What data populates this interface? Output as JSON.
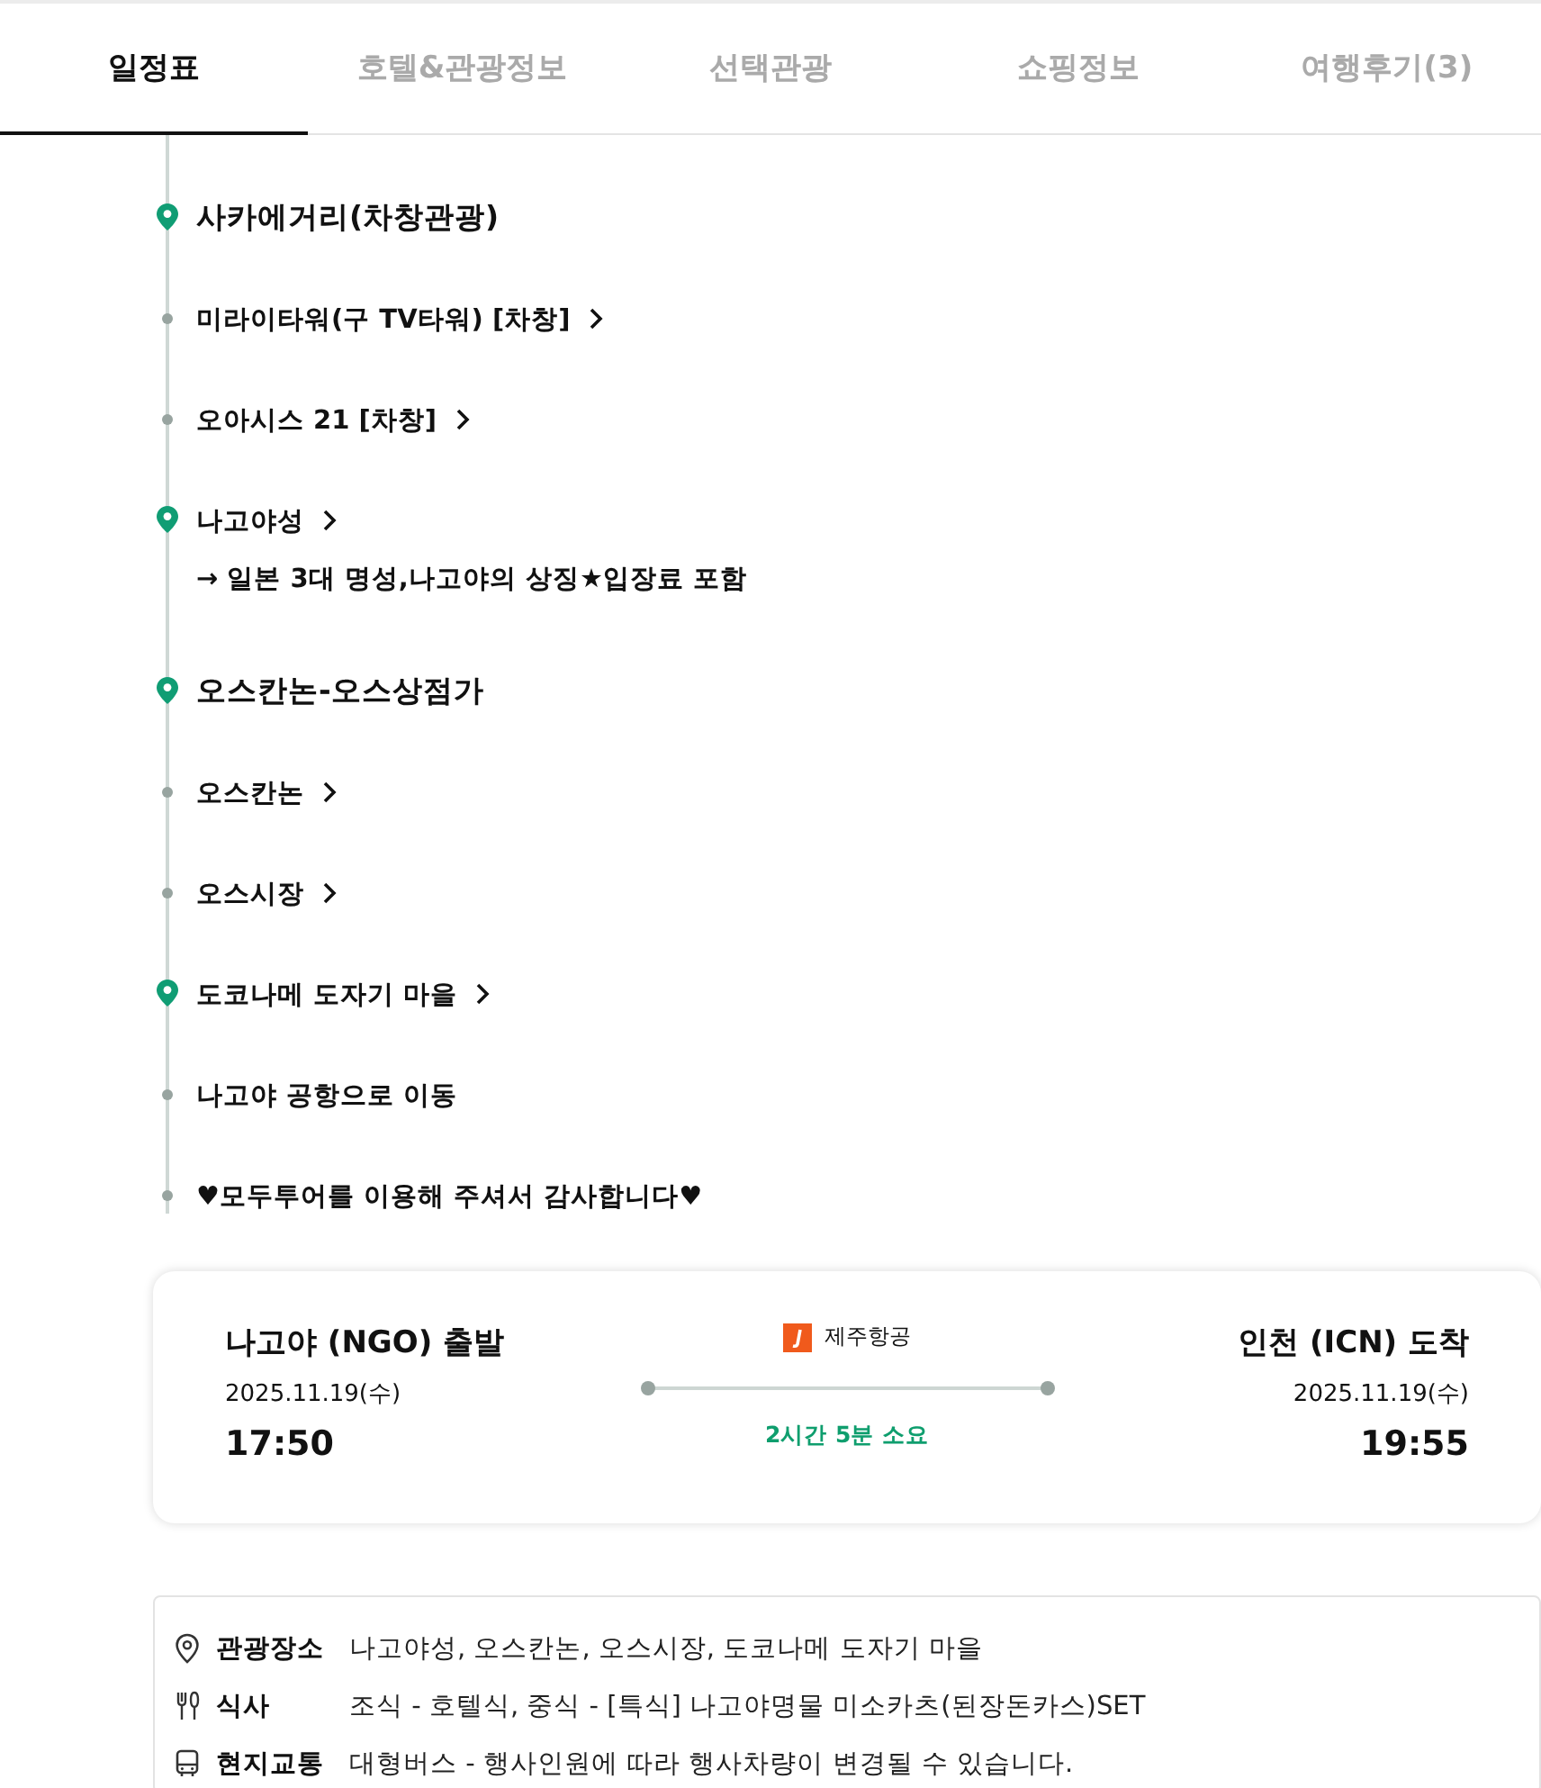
{
  "tabs": [
    {
      "label": "일정표",
      "selected": true
    },
    {
      "label": "호텔&관광정보",
      "selected": false
    },
    {
      "label": "선택관광",
      "selected": false
    },
    {
      "label": "쇼핑정보",
      "selected": false
    },
    {
      "label": "여행후기(3)",
      "selected": false
    }
  ],
  "itinerary": [
    {
      "kind": "place",
      "name": "사카에거리(차창관광)",
      "link": false
    },
    {
      "kind": "stop",
      "name": "미라이타워(구 TV타워) [차창]",
      "link": true
    },
    {
      "kind": "stop",
      "name": "오아시스 21 [차창]",
      "link": true
    },
    {
      "kind": "spot",
      "name": "나고야성",
      "link": true,
      "note": "→ 일본 3대 명성,나고야의 상징★입장료 포함"
    },
    {
      "kind": "place",
      "name": "오스칸논-오스상점가",
      "link": false
    },
    {
      "kind": "stop",
      "name": "오스칸논",
      "link": true
    },
    {
      "kind": "stop",
      "name": "오스시장",
      "link": true
    },
    {
      "kind": "spot",
      "name": "도코나메 도자기 마을",
      "link": true
    },
    {
      "kind": "stop",
      "name": "나고야 공항으로 이동",
      "link": false
    },
    {
      "kind": "stop",
      "name": "♥모두투어를 이용해 주셔서 감사합니다♥",
      "link": false
    }
  ],
  "flight": {
    "departure": {
      "airport": "나고야 (NGO) 출발",
      "date": "2025.11.19(수)",
      "time": "17:50"
    },
    "airline": "제주항공",
    "duration": "2시간 5분 소요",
    "arrival": {
      "airport": "인천 (ICN) 도착",
      "date": "2025.11.19(수)",
      "time": "19:55"
    }
  },
  "details": [
    {
      "kind": "sights",
      "label": "관광장소",
      "value": "나고야성, 오스칸논, 오스시장, 도코나메 도자기 마을"
    },
    {
      "kind": "meal",
      "label": "식사",
      "value": "조식 - 호텔식, 중식 - [특식] 나고야명물 미소카츠(된장돈카스)SET"
    },
    {
      "kind": "transport",
      "label": "현지교통",
      "value": "대형버스 - 행사인원에 따라 행사차량이 변경될 수 있습니다."
    }
  ]
}
